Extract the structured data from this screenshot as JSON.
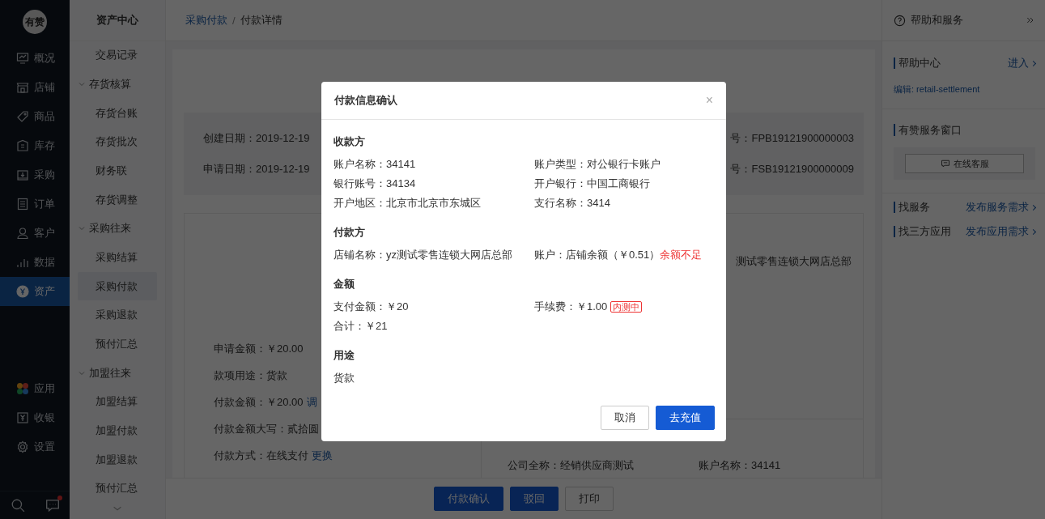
{
  "nav": {
    "logo": "有赞",
    "items": [
      {
        "label": "概况",
        "selected": false
      },
      {
        "label": "店铺",
        "selected": false
      },
      {
        "label": "商品",
        "selected": false
      },
      {
        "label": "库存",
        "selected": false
      },
      {
        "label": "采购",
        "selected": false
      },
      {
        "label": "订单",
        "selected": false
      },
      {
        "label": "客户",
        "selected": false
      },
      {
        "label": "数据",
        "selected": false
      },
      {
        "label": "资产",
        "selected": true
      }
    ],
    "bottom_items": [
      {
        "label": "应用",
        "selected": false
      },
      {
        "label": "收银",
        "selected": false
      },
      {
        "label": "设置",
        "selected": false
      }
    ],
    "chat_unread": true
  },
  "subnav": {
    "title": "资产中心",
    "items": [
      {
        "label": "交易记录",
        "selected": false
      },
      {
        "label": "存货核算",
        "expanded": true,
        "children": [
          {
            "label": "存货台账",
            "selected": false
          },
          {
            "label": "存货批次",
            "selected": false
          },
          {
            "label": "财务联",
            "selected": false
          },
          {
            "label": "存货调整",
            "selected": false
          }
        ]
      },
      {
        "label": "采购往来",
        "expanded": true,
        "children": [
          {
            "label": "采购结算",
            "selected": false
          },
          {
            "label": "采购付款",
            "selected": true
          },
          {
            "label": "采购退款",
            "selected": false
          },
          {
            "label": "预付汇总",
            "selected": false
          }
        ]
      },
      {
        "label": "加盟往来",
        "expanded": true,
        "children": [
          {
            "label": "加盟结算",
            "selected": false
          },
          {
            "label": "加盟付款",
            "selected": false
          },
          {
            "label": "加盟退款",
            "selected": false
          },
          {
            "label": "预付汇总",
            "selected": false
          }
        ]
      }
    ]
  },
  "breadcrumb_separator": "/",
  "breadcrumb": [
    {
      "label": "采购付款",
      "kind": "link"
    },
    {
      "label": "付款详情",
      "kind": "current"
    }
  ],
  "page": {
    "info_rows": [
      {
        "left": "创建日期：2019-12-19",
        "right": "号：FPB19121900000003"
      },
      {
        "left": "申请日期：2019-12-19",
        "right": "号：FSB19121900000009"
      }
    ],
    "detail_fields": [
      {
        "text": "申请金额：￥20.00"
      },
      {
        "text": "款项用途：货款"
      },
      {
        "text": "付款金额：￥20.00",
        "link": "调"
      },
      {
        "text": "付款金额大写：贰拾圆"
      },
      {
        "text": "付款方式：在线支付",
        "link": "更换"
      }
    ],
    "store_name": "测试零售连锁大网店总部",
    "supplier_fields": [
      "公司全称：经销供应商测试",
      "账户名称：34141"
    ],
    "actions": [
      {
        "label": "付款确认",
        "kind": "primary"
      },
      {
        "label": "驳回",
        "kind": "primary"
      },
      {
        "label": "打印",
        "kind": "default"
      }
    ]
  },
  "help": {
    "title": "帮助和服务",
    "center_title": "帮助中心",
    "center_link": "进入",
    "edit_link": "编辑: retail-settlement",
    "window_title": "有赞服务窗口",
    "service_button": "在线客服",
    "finds": [
      {
        "label": "找服务",
        "link": "发布服务需求"
      },
      {
        "label": "找三方应用",
        "link": "发布应用需求"
      }
    ]
  },
  "dialog": {
    "title": "付款信息确认",
    "close": "×",
    "sections": [
      {
        "title": "收款方",
        "fields": [
          {
            "text": "账户名称：34141"
          },
          {
            "text": "账户类型：对公银行卡账户"
          },
          {
            "text": "银行账号：34134"
          },
          {
            "text": "开户银行：中国工商银行"
          },
          {
            "text": "开户地区：北京市北京市东城区"
          },
          {
            "text": "支行名称：3414"
          }
        ]
      },
      {
        "title": "付款方",
        "fields": [
          {
            "text": "店铺名称：yz测试零售连锁大网店总部"
          },
          {
            "text": "账户：店铺余额（￥0.51）",
            "warning": "余额不足"
          }
        ]
      },
      {
        "title": "金额",
        "fields": [
          {
            "text": "支付金额：￥20"
          },
          {
            "text": "手续费：￥1.00",
            "tag": "内测中"
          },
          {
            "text": "合计：￥21"
          }
        ]
      },
      {
        "title": "用途",
        "fields": [
          {
            "text": "货款"
          }
        ]
      }
    ],
    "buttons": [
      {
        "label": "取消",
        "kind": "default"
      },
      {
        "label": "去充值",
        "kind": "primary"
      }
    ]
  }
}
